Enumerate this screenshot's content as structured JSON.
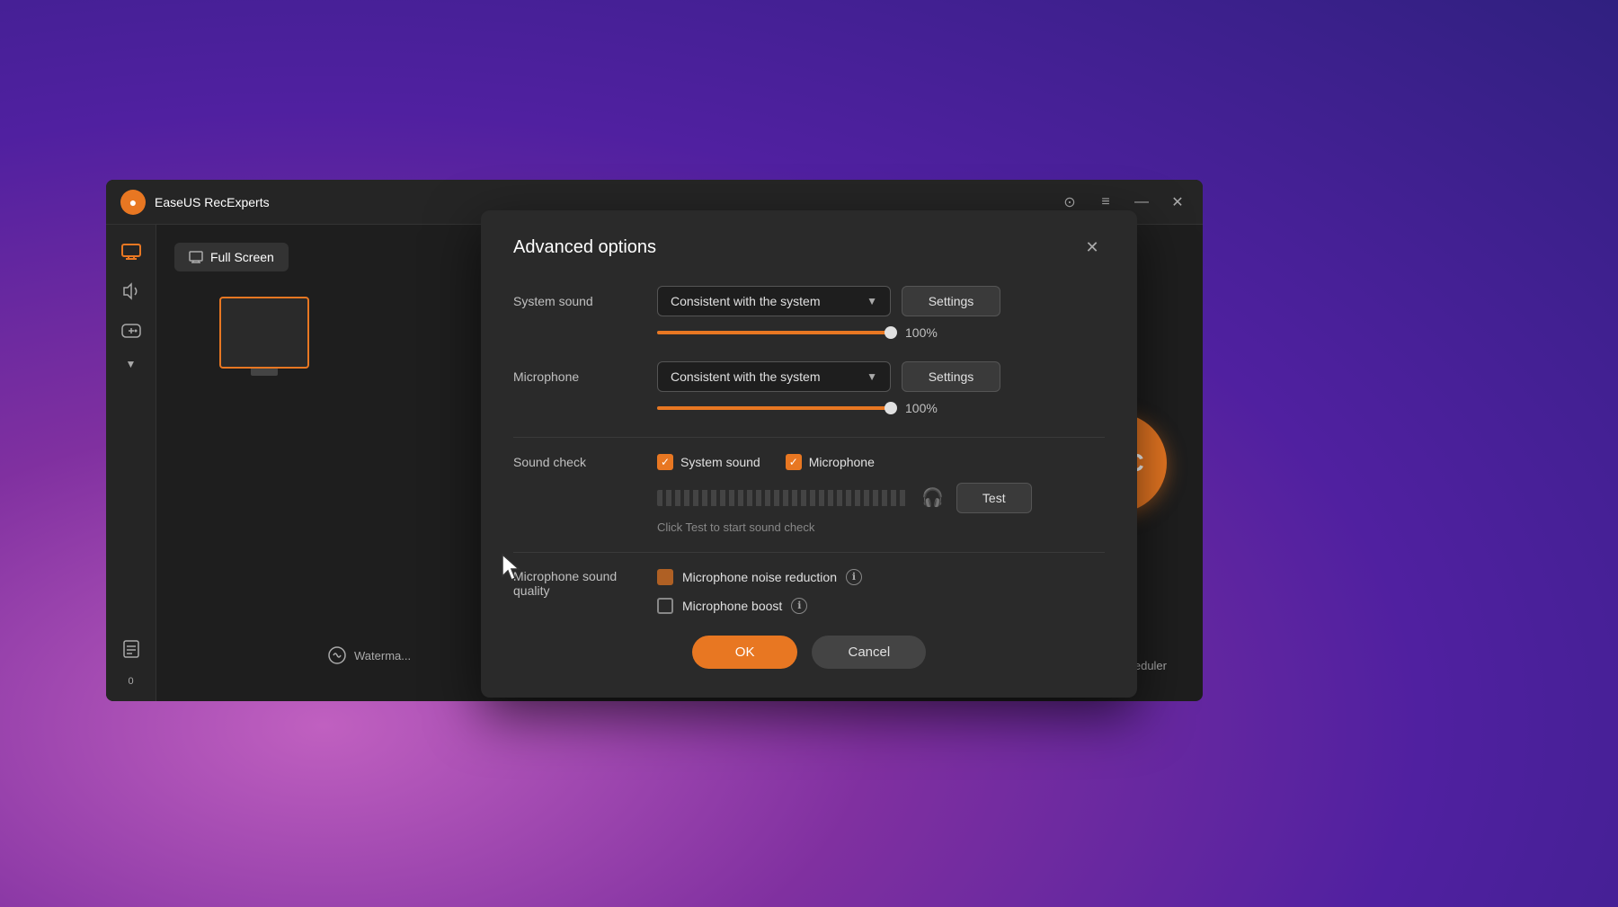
{
  "background": {
    "type": "radial-gradient"
  },
  "main_window": {
    "title": "EaseUS RecExperts",
    "mode_label": "Full Screen",
    "watermark_label": "Waterma...",
    "rec_button_label": "REC",
    "task_scheduler_label": "Task scheduler",
    "titlebar_buttons": {
      "shield_label": "⊙",
      "menu_label": "≡",
      "minimize_label": "—",
      "close_label": "✕"
    }
  },
  "dialog": {
    "title": "Advanced options",
    "close_label": "✕",
    "system_sound": {
      "label": "System sound",
      "dropdown_value": "Consistent with the system",
      "settings_label": "Settings",
      "volume_percent": "100%",
      "volume_value": 100
    },
    "microphone": {
      "label": "Microphone",
      "dropdown_value": "Consistent with the system",
      "settings_label": "Settings",
      "volume_percent": "100%",
      "volume_value": 100
    },
    "sound_check": {
      "label": "Sound check",
      "system_sound_label": "System sound",
      "microphone_label": "Microphone",
      "system_sound_checked": true,
      "microphone_checked": true,
      "test_button_label": "Test",
      "hint_text": "Click Test to start sound check"
    },
    "microphone_sound_quality": {
      "label": "Microphone sound\nquality",
      "noise_reduction_label": "Microphone noise reduction",
      "noise_reduction_checked": true,
      "boost_label": "Microphone boost",
      "boost_checked": false,
      "info_icon_label": "ℹ"
    },
    "ok_label": "OK",
    "cancel_label": "Cancel"
  }
}
